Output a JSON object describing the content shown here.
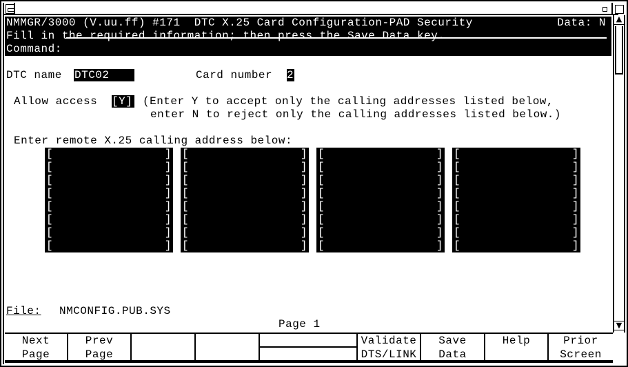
{
  "window": {
    "system_menu_icon": "system-menu-icon",
    "minimize_icon": "minimize-icon",
    "maximize_icon": "maximize-icon"
  },
  "header": {
    "title": "NMMGR/3000 (V.uu.ff) #171  DTC X.25 Card Configuration-PAD Security",
    "data_flag": "Data: N",
    "instruction": "Fill in the required information; then press the Save Data key.",
    "command_label": "Command:",
    "command_value": ""
  },
  "form": {
    "dtc_name_label": "DTC name",
    "dtc_name_value": "DTC02",
    "card_number_label": "Card number",
    "card_number_value": "2",
    "allow_access_label": "Allow access",
    "allow_access_value": "[Y]",
    "allow_help_line1": "(Enter Y to accept only the calling addresses listed below,",
    "allow_help_line2": "enter N to reject only the calling addresses listed below.)",
    "address_label": "Enter remote X.25 calling address below:",
    "address_columns": [
      [
        "",
        "",
        "",
        "",
        "",
        "",
        "",
        ""
      ],
      [
        "",
        "",
        "",
        "",
        "",
        "",
        "",
        ""
      ],
      [
        "",
        "",
        "",
        "",
        "",
        "",
        "",
        ""
      ],
      [
        "",
        "",
        "",
        "",
        "",
        "",
        "",
        ""
      ]
    ],
    "bracket_open": "[",
    "bracket_close": "]"
  },
  "footer": {
    "file_label": "File:",
    "file_value": "NMCONFIG.PUB.SYS",
    "page_indicator": "Page 1"
  },
  "softkeys": [
    {
      "line1": "Next",
      "line2": "Page"
    },
    {
      "line1": "Prev",
      "line2": "Page"
    },
    {
      "line1": "",
      "line2": ""
    },
    {
      "line1": "",
      "line2": ""
    },
    {
      "line1": "",
      "line2": ""
    },
    {
      "line1": "Validate",
      "line2": "DTS/LINK"
    },
    {
      "line1": "Save",
      "line2": "Data"
    },
    {
      "line1": "Help",
      "line2": ""
    },
    {
      "line1": "Prior",
      "line2": "Screen"
    }
  ],
  "scrollbar": {
    "up_glyph": "▲",
    "down_glyph": "▼",
    "position": 0
  }
}
